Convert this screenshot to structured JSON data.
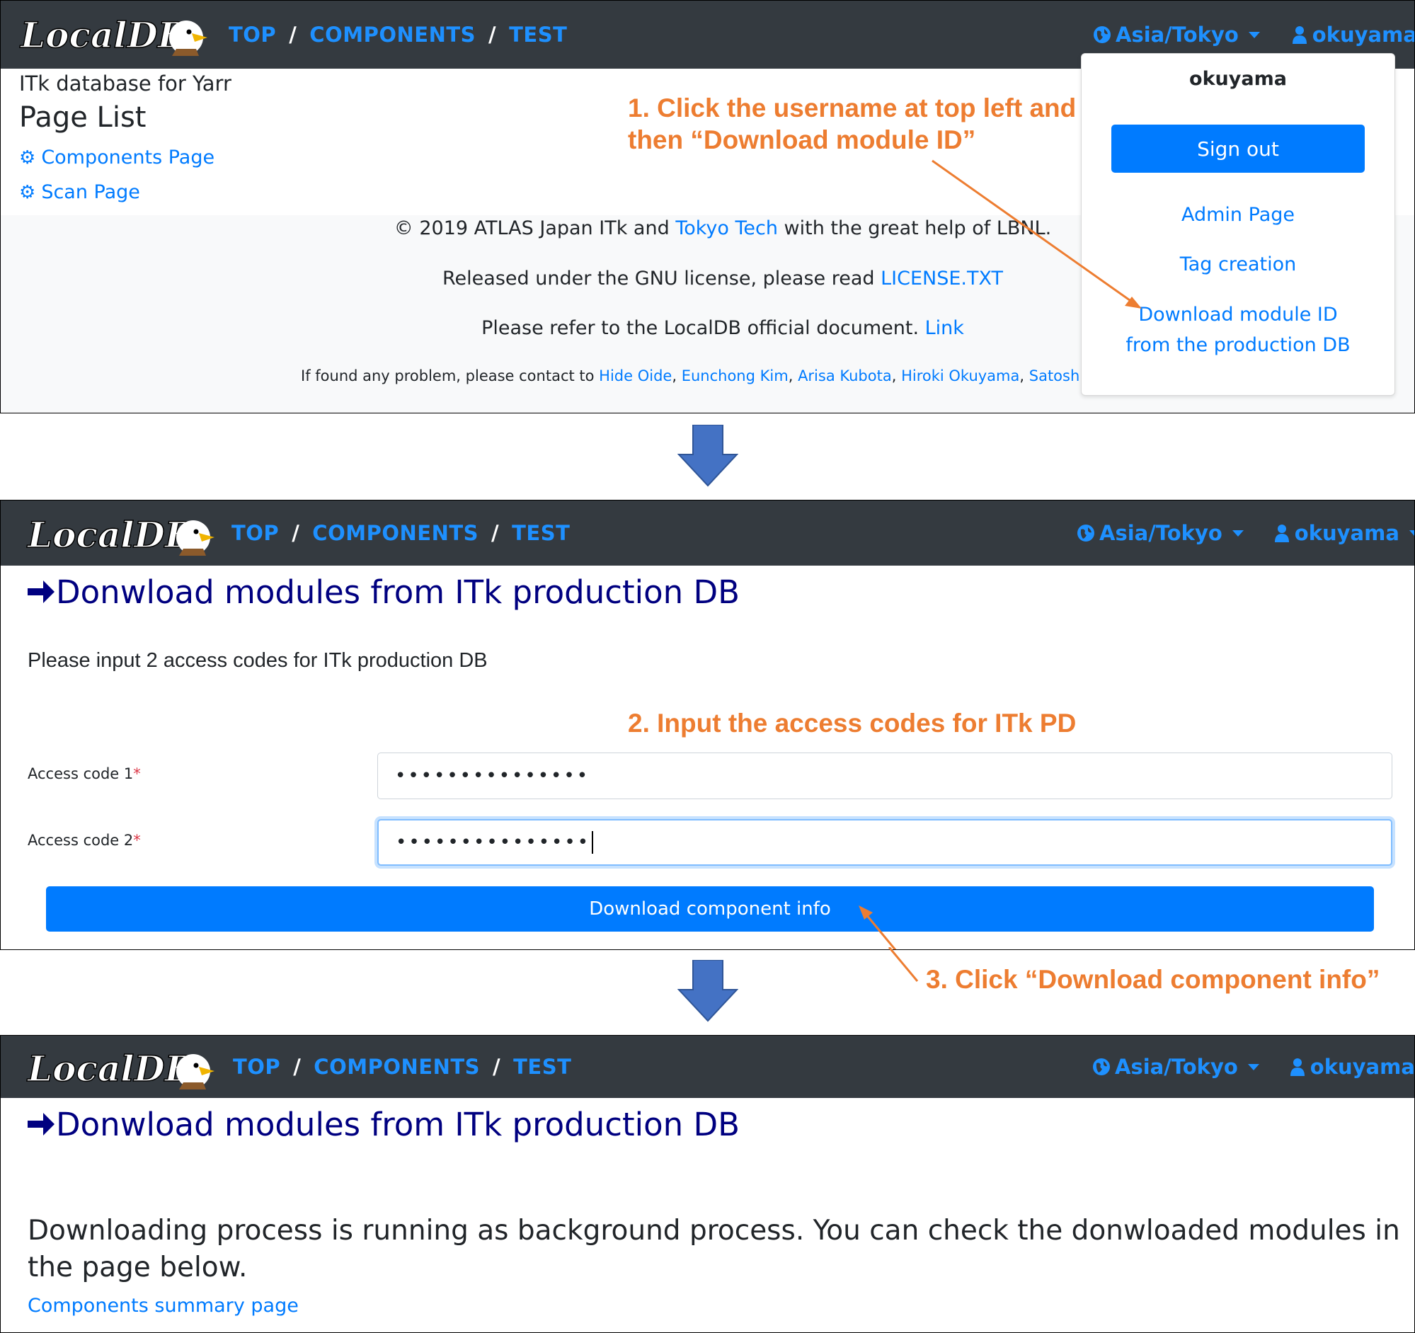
{
  "nav": {
    "logo_text": "LocalDB",
    "breadcrumb": [
      "TOP",
      "COMPONENTS",
      "TEST"
    ],
    "separator": "/",
    "timezone": "Asia/Tokyo",
    "username": "okuyama"
  },
  "panel1": {
    "subtitle": "ITk database for Yarr",
    "title": "Page List",
    "links": [
      "Components Page",
      "Scan Page"
    ],
    "footer": {
      "line1_pre": "© 2019 ATLAS Japan ITk and ",
      "line1_link": "Tokyo Tech",
      "line1_post": " with the great help of LBNL.",
      "line2_pre": "Released under the GNU license, please read ",
      "line2_link": "LICENSE.TXT",
      "line3_pre": "Please refer to the LocalDB official document. ",
      "line3_link": "Link",
      "line4_pre": "If found any problem, please contact to ",
      "contacts": [
        "Hide Oide",
        "Eunchong Kim",
        "Arisa Kubota",
        "Hiroki Okuyama",
        "Satoshi Ki"
      ],
      "comma": ","
    },
    "dropdown": {
      "username": "okuyama",
      "signout": "Sign out",
      "admin": "Admin Page",
      "tag": "Tag creation",
      "download_line1": "Download module ID",
      "download_line2": "from the production DB"
    }
  },
  "panel2": {
    "heading": "Donwload modules from ITk production DB",
    "instruction": "Please input 2 access codes for ITk production DB",
    "label1": "Access code 1",
    "label2": "Access code 2",
    "required_mark": "*",
    "value1": "•••••••••••••••",
    "value2": "•••••••••••••••",
    "button": "Download component info"
  },
  "panel3": {
    "heading": "Donwload modules from ITk production DB",
    "message": "Downloading process is running as background process. You can check the donwloaded modules in the page below.",
    "link": "Components summary page"
  },
  "annotations": {
    "step1_line1": "1. Click the username at top left and",
    "step1_line2": "then “Download module ID”",
    "step2": "2. Input the access codes for ITk PD",
    "step3": "3. Click “Download component info”"
  },
  "colors": {
    "navbar": "#343a40",
    "link": "#007bff",
    "nav_link": "#1e90ff",
    "heading": "#000080",
    "annotation": "#ed7d31",
    "flow_arrow": "#4472c4"
  },
  "icons": [
    "globe-icon",
    "user-icon",
    "gear-icon",
    "right-arrow-icon",
    "caret-down-icon",
    "down-arrow-icon"
  ]
}
